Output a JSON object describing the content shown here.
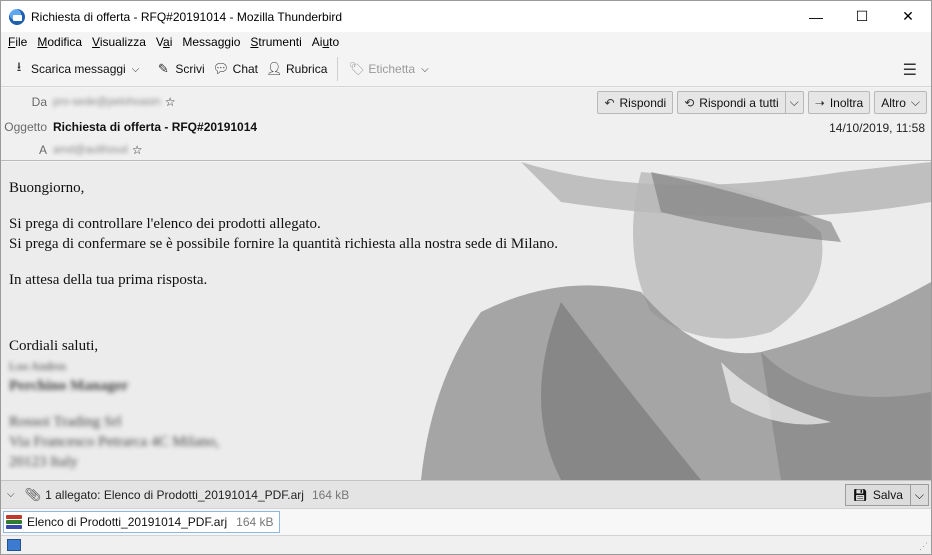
{
  "window": {
    "title": "Richiesta di offerta - RFQ#20191014 - Mozilla Thunderbird",
    "minimize": "—",
    "maximize": "☐",
    "close": "✕"
  },
  "menu": [
    {
      "label": "File",
      "u": "F",
      "rest": "ile"
    },
    {
      "label": "Modifica",
      "u": "M",
      "rest": "odifica"
    },
    {
      "label": "Visualizza",
      "u": "V",
      "rest": "isualizza"
    },
    {
      "label": "Vai",
      "pre": "V",
      "u": "a",
      "rest": "i"
    },
    {
      "label": "Messaggio",
      "pre": "Messa",
      "u": "g",
      "rest": "gio"
    },
    {
      "label": "Strumenti",
      "u": "S",
      "rest": "trumenti"
    },
    {
      "label": "Aiuto",
      "pre": "Ai",
      "u": "u",
      "rest": "to"
    }
  ],
  "toolbar": {
    "get_messages": "Scarica messaggi",
    "write": "Scrivi",
    "chat": "Chat",
    "address_book": "Rubrica",
    "tag": "Etichetta",
    "menu_icon": "hamburger-menu-icon"
  },
  "header": {
    "from_label": "Da",
    "from_value": "pro-sede@pelohoasin",
    "subject_label": "Oggetto",
    "subject": "Richiesta di offerta - RFQ#20191014",
    "to_label": "A",
    "to_value": "amd@aulthoud",
    "date": "14/10/2019, 11:58",
    "reply": "Rispondi",
    "reply_all": "Rispondi a tutti",
    "forward": "Inoltra",
    "more": "Altro"
  },
  "body": {
    "greeting": "Buongiorno,",
    "line1": "Si prega di controllare l'elenco dei prodotti allegato.",
    "line2": "Si prega di confermare se è possibile fornire la quantità richiesta alla nostra sede di Milano.",
    "line3": "In attesa della tua prima risposta.",
    "closing": "Cordiali saluti,",
    "sig_name": "Loo Andros",
    "sig_role": "Perchino Manager",
    "sig_company": "Rossoi Trading Srl",
    "sig_address": "Via Francesco Petrarca 4C Milano,",
    "sig_zip": "20123 Italy"
  },
  "attachments": {
    "summary": "1 allegato: Elenco di Prodotti_20191014_PDF.arj",
    "summary_size": "164 kB",
    "save": "Salva",
    "items": [
      {
        "name": "Elenco di Prodotti_20191014_PDF.arj",
        "size": "164 kB"
      }
    ]
  },
  "colors": {
    "accent": "#1e5fae",
    "rar_stripes": [
      "#c0392b",
      "#2e7d32",
      "#3949ab"
    ]
  }
}
